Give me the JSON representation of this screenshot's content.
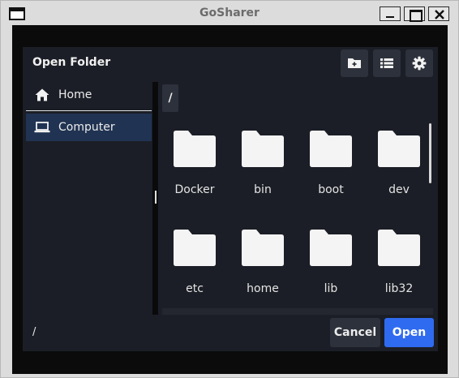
{
  "window": {
    "title": "GoSharer"
  },
  "dialog": {
    "title": "Open Folder",
    "toolbar": {
      "new_folder_icon": "folder-plus-icon",
      "list_view_icon": "list-icon",
      "settings_icon": "gear-icon"
    },
    "sidebar": {
      "items": [
        {
          "label": "Home",
          "icon": "home-icon",
          "selected": false
        },
        {
          "label": "Computer",
          "icon": "laptop-icon",
          "selected": true
        }
      ]
    },
    "path": "/",
    "folders": [
      {
        "name": "Docker"
      },
      {
        "name": "bin"
      },
      {
        "name": "boot"
      },
      {
        "name": "dev"
      },
      {
        "name": "etc"
      },
      {
        "name": "home"
      },
      {
        "name": "lib"
      },
      {
        "name": "lib32"
      }
    ],
    "footer": {
      "current_path": "/",
      "cancel_label": "Cancel",
      "open_label": "Open"
    }
  },
  "colors": {
    "accent": "#2f6bf0",
    "selected_bg": "#213352",
    "dialog_bg": "#1b1e26",
    "button_bg": "#2d313b",
    "folder": "#f4f4f4"
  }
}
